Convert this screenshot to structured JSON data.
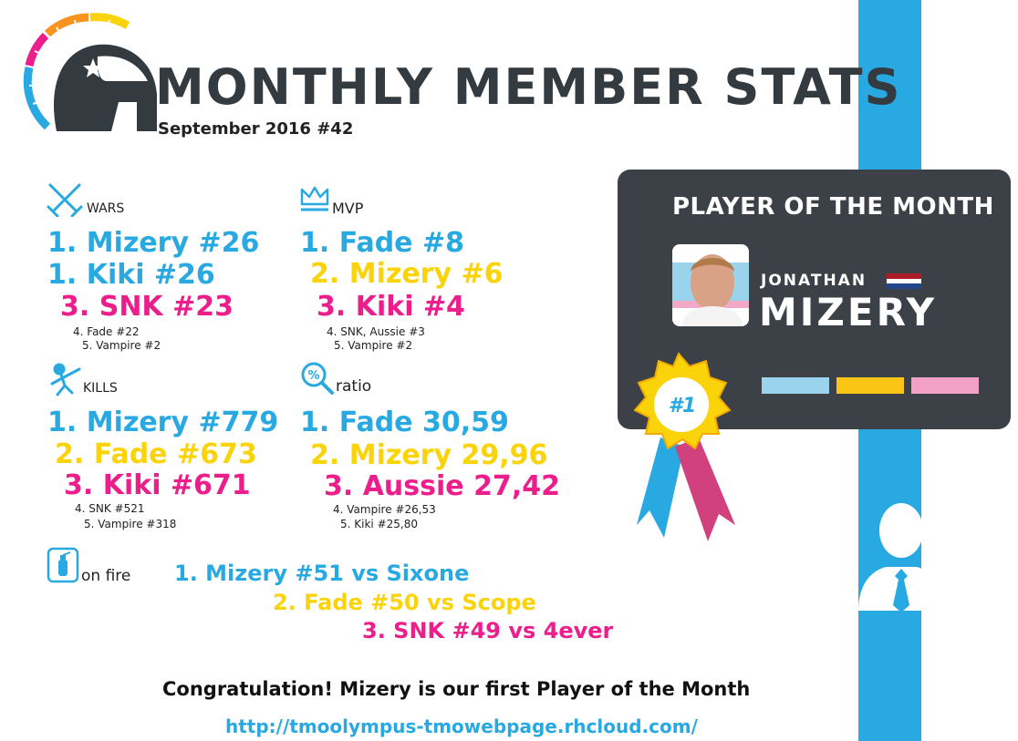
{
  "header": {
    "title": "MONTHLY MEMBER STATS",
    "subtitle": "September 2016 #42"
  },
  "wars": {
    "label": "WARS",
    "first": "1. Mizery #26",
    "first_tie": "1. Kiki #26",
    "third": "3. SNK #23",
    "fourth": "4. Fade #22",
    "fifth": "5. Vampire #2"
  },
  "mvp": {
    "label": "MVP",
    "first": "1. Fade #8",
    "second": "2. Mizery #6",
    "third": "3. Kiki #4",
    "fourth": "4. SNK, Aussie #3",
    "fifth": "5. Vampire #2"
  },
  "kills": {
    "label": "KILLS",
    "first": "1. Mizery #779",
    "second": "2. Fade #673",
    "third": "3. Kiki #671",
    "fourth": "4. SNK #521",
    "fifth": "5. Vampire #318"
  },
  "ratio": {
    "label": "ratio",
    "first": "1. Fade 30,59",
    "second": "2. Mizery 29,96",
    "third": "3. Aussie 27,42",
    "fourth": "4. Vampire #26,53",
    "fifth": "5. Kiki #25,80"
  },
  "on_fire": {
    "label": "on fire",
    "first": "1. Mizery #51 vs Sixone",
    "second": "2. Fade #50 vs Scope",
    "third": "3. SNK #49 vs 4ever"
  },
  "player_card": {
    "title": "PLAYER OF THE MONTH",
    "first_name": "JONATHAN",
    "nickname": "MIZERY",
    "badge": "#1"
  },
  "footer": {
    "congrats": "Congratulation! Mizery is our first Player of the Month",
    "url": "http://tmoolympus-tmowebpage.rhcloud.com/"
  },
  "colors": {
    "blue": "#29a9e1",
    "yellow": "#fbd30a",
    "pink": "#ec1e8c",
    "card": "#3c4147"
  }
}
